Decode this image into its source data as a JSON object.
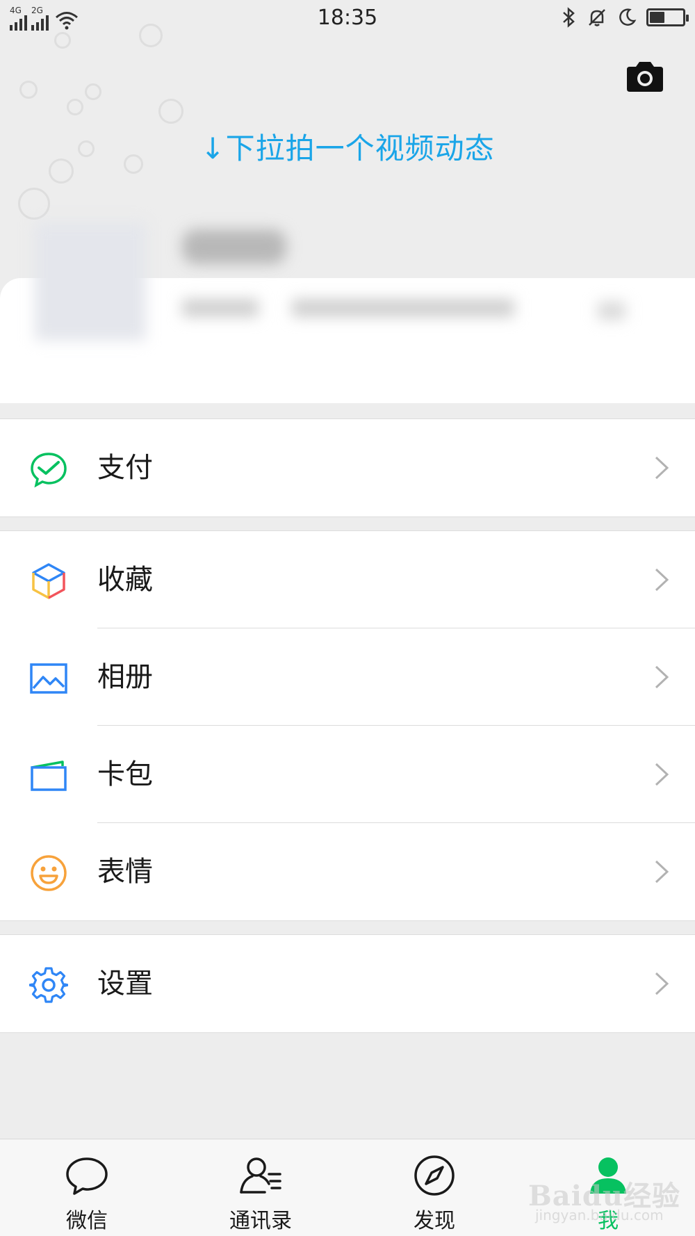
{
  "status_bar": {
    "network1": "4G",
    "network2": "2G",
    "time": "18:35",
    "battery_level": 0.45
  },
  "header": {
    "pull_hint": "↓下拉拍一个视频动态",
    "camera_icon": "camera-icon"
  },
  "menu": {
    "pay": {
      "label": "支付",
      "icon": "wechat-pay-icon"
    },
    "favorites": {
      "label": "收藏",
      "icon": "cube-icon"
    },
    "album": {
      "label": "相册",
      "icon": "image-icon"
    },
    "card_wallet": {
      "label": "卡包",
      "icon": "card-icon"
    },
    "stickers": {
      "label": "表情",
      "icon": "smiley-icon"
    },
    "settings": {
      "label": "设置",
      "icon": "gear-icon"
    }
  },
  "tabbar": {
    "tabs": [
      {
        "label": "微信",
        "icon": "chat-bubble-icon"
      },
      {
        "label": "通讯录",
        "icon": "contacts-icon"
      },
      {
        "label": "发现",
        "icon": "compass-icon"
      },
      {
        "label": "我",
        "icon": "person-icon",
        "active": true
      }
    ]
  },
  "colors": {
    "accent_green": "#07c160",
    "hint_blue": "#1aa5e8",
    "background": "#ededed"
  },
  "watermark": {
    "brand": "Baidu经验",
    "url": "jingyan.baidu.com"
  }
}
